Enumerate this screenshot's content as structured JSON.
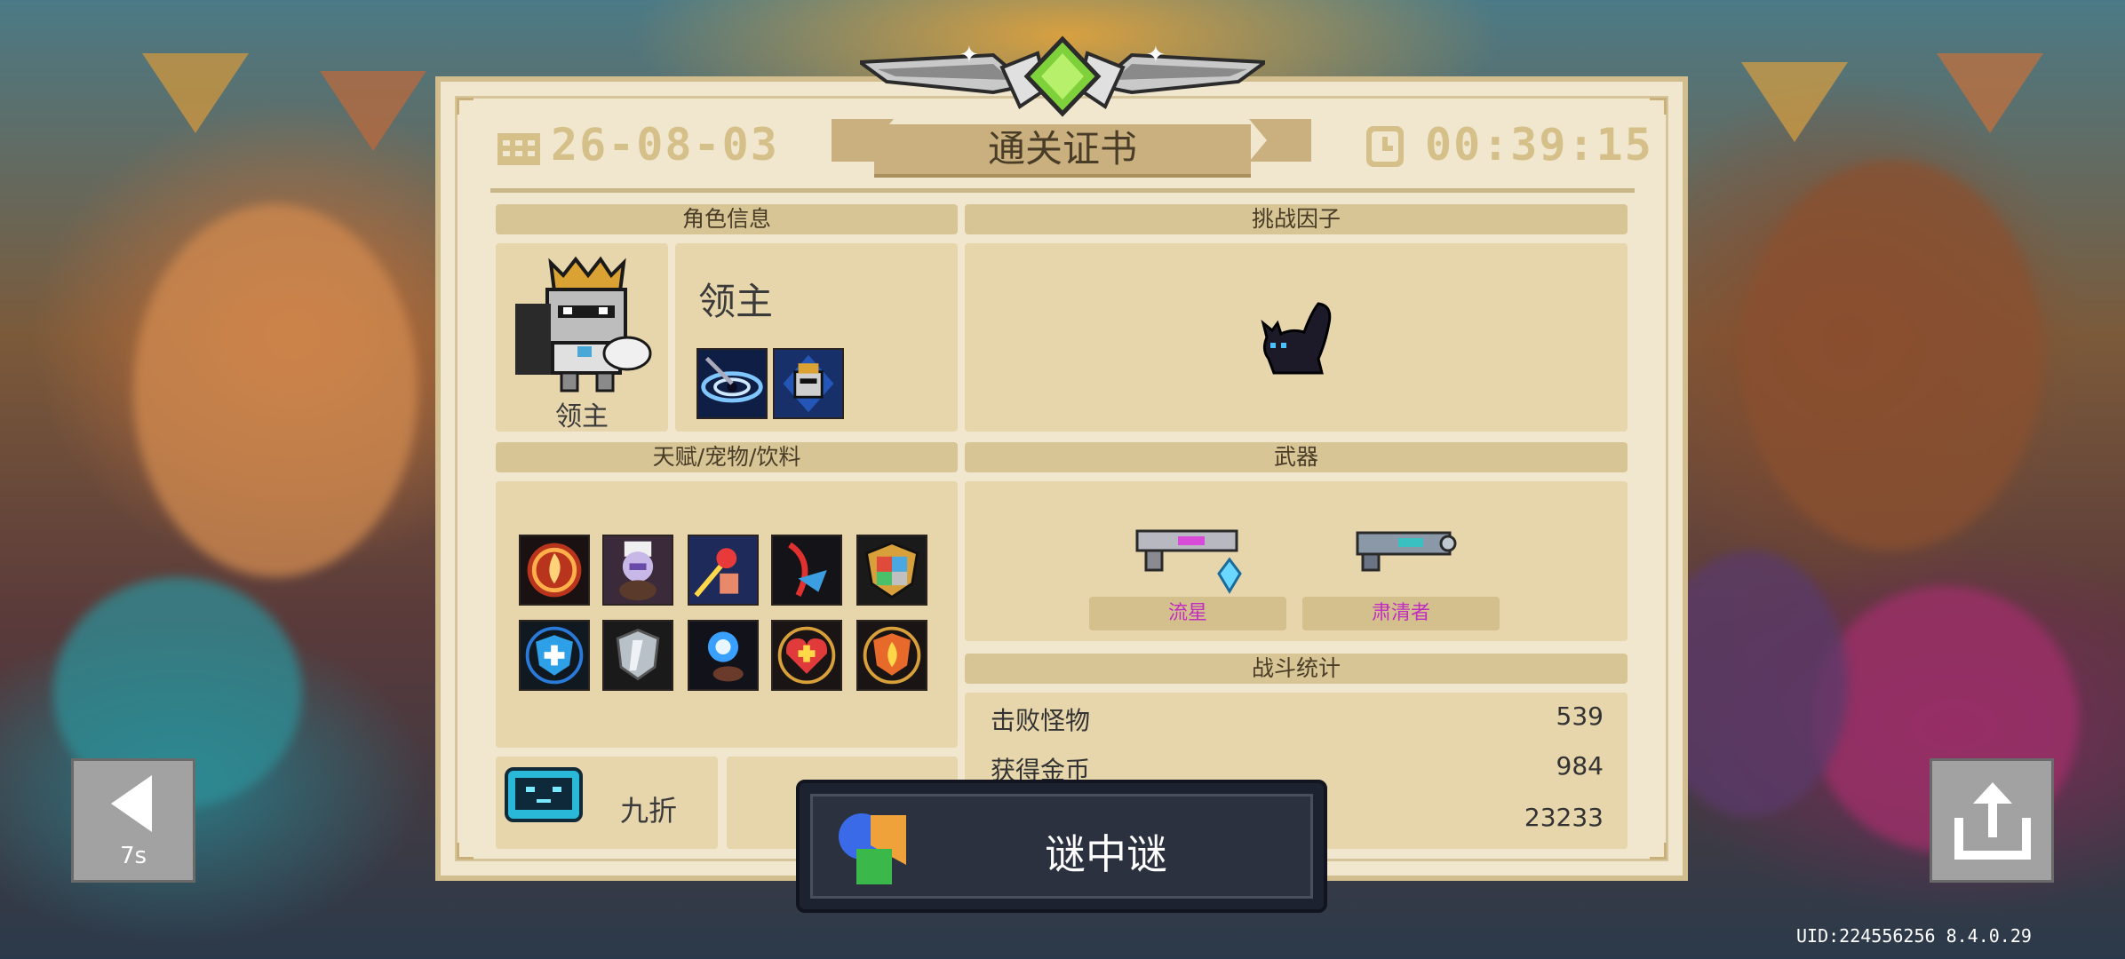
{
  "header": {
    "date": "26-08-03",
    "title": "通关证书",
    "time": "00:39:15"
  },
  "character": {
    "section_title": "角色信息",
    "name": "领主",
    "portrait_label": "领主",
    "skills": [
      "vortex-skill-icon",
      "knight-shield-skill-icon"
    ]
  },
  "challenge": {
    "section_title": "挑战因子",
    "factor_icon": "black-cat-icon"
  },
  "talents": {
    "section_title": "天赋/宠物/饮料",
    "row1": [
      "fire-swirl-icon",
      "chef-pet-icon",
      "fist-punch-icon",
      "blade-slash-icon",
      "elemental-shield-icon"
    ],
    "row2": [
      "shield-plus-icon",
      "silver-shield-icon",
      "energy-orb-icon",
      "heart-plus-icon",
      "flame-shield-icon"
    ]
  },
  "weapons": {
    "section_title": "武器",
    "items": [
      {
        "name": "流星",
        "icon": "shotgun-icon",
        "color": "#c02ec0"
      },
      {
        "name": "肃清者",
        "icon": "blaster-icon",
        "color": "#c02ec0"
      }
    ]
  },
  "stats": {
    "section_title": "战斗统计",
    "rows": [
      {
        "label": "击败怪物",
        "value": "539"
      },
      {
        "label": "获得金币",
        "value": "984"
      },
      {
        "label": "",
        "value": "23233"
      }
    ]
  },
  "discount": {
    "icon": "tv-robot-icon",
    "label": "九折"
  },
  "popup": {
    "icon": "game-center-icon",
    "text": "谜中谜"
  },
  "back_button": {
    "countdown": "7s"
  },
  "share_button": {
    "icon": "share-icon"
  },
  "footer": {
    "uid": "UID:224556256 8.4.0.29"
  }
}
